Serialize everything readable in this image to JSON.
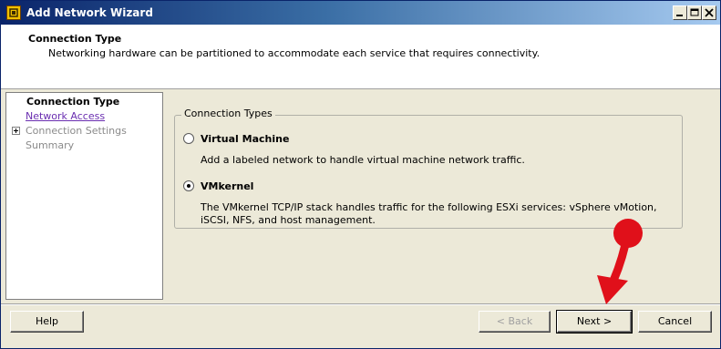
{
  "window": {
    "title": "Add Network Wizard"
  },
  "header": {
    "title": "Connection Type",
    "subtitle": "Networking hardware can be partitioned to accommodate each service that requires connectivity."
  },
  "nav": {
    "current": "Connection Type",
    "link": "Network Access",
    "settings": "Connection Settings",
    "summary": "Summary"
  },
  "group": {
    "legend": "Connection Types",
    "options": [
      {
        "label": "Virtual Machine",
        "desc": "Add a labeled network to handle virtual machine network traffic.",
        "selected": false
      },
      {
        "label": "VMkernel",
        "desc": "The VMkernel TCP/IP stack handles traffic for the following ESXi services: vSphere vMotion, iSCSI, NFS, and host management.",
        "selected": true
      }
    ]
  },
  "buttons": {
    "help": "Help",
    "back": "< Back",
    "next": "Next >",
    "cancel": "Cancel"
  },
  "colors": {
    "annotation": "#e0101a"
  }
}
